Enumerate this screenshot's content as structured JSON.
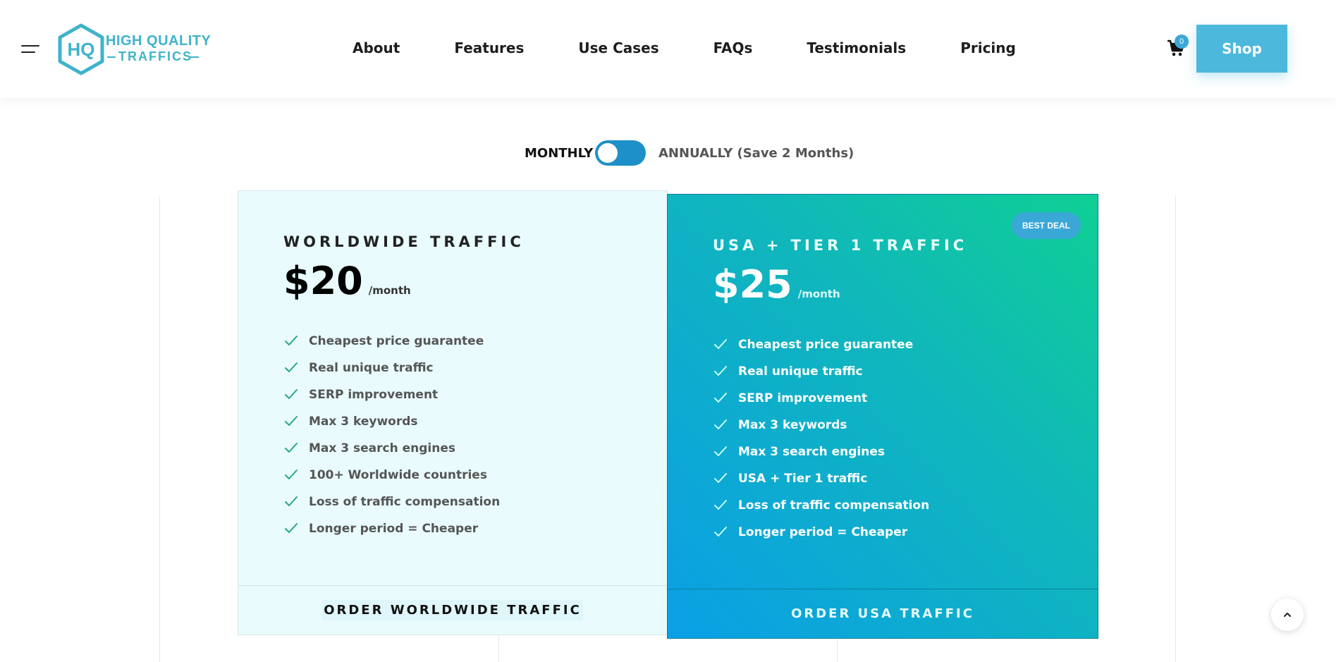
{
  "header": {
    "logo": {
      "line1": "HIGH QUALITY",
      "line2": "TRAFFICS",
      "mark": "HQ"
    },
    "nav": [
      "About",
      "Features",
      "Use Cases",
      "FAQs",
      "Testimonials",
      "Pricing"
    ],
    "cart_count": "0",
    "shop_label": "Shop"
  },
  "billing": {
    "monthly_label": "MONTHLY",
    "annual_label": "ANNUALLY (Save 2 Months)",
    "annual_selected": 0
  },
  "plans": [
    {
      "title": "WORLDWIDE TRAFFIC",
      "price": "$20",
      "period": "/month",
      "features": [
        "Cheapest price guarantee",
        "Real unique traffic",
        "SERP improvement",
        "Max 3 keywords",
        "Max 3 search engines",
        "100+ Worldwide countries",
        "Loss of traffic compensation",
        "Longer period = Cheaper"
      ],
      "order_label": "ORDER WORLDWIDE TRAFFIC"
    },
    {
      "title": "USA + TIER 1 TRAFFIC",
      "price": "$25",
      "period": "/month",
      "badge": "BEST DEAL",
      "features": [
        "Cheapest price guarantee",
        "Real unique traffic",
        "SERP improvement",
        "Max 3 keywords",
        "Max 3 search engines",
        "USA + Tier 1 traffic",
        "Loss of traffic compensation",
        "Longer period = Cheaper"
      ],
      "order_label": "ORDER USA TRAFFIC"
    }
  ],
  "colors": {
    "accent": "#3aa8d6",
    "shop_button": "#4cb9dc",
    "check_worldwide": "#2aa58a",
    "check_usa": "#c8fff0"
  },
  "icons": {
    "menu": "hamburger-menu-icon",
    "cart": "shopping-cart-icon",
    "check": "check-icon",
    "scroll_top": "chevron-up-icon"
  }
}
